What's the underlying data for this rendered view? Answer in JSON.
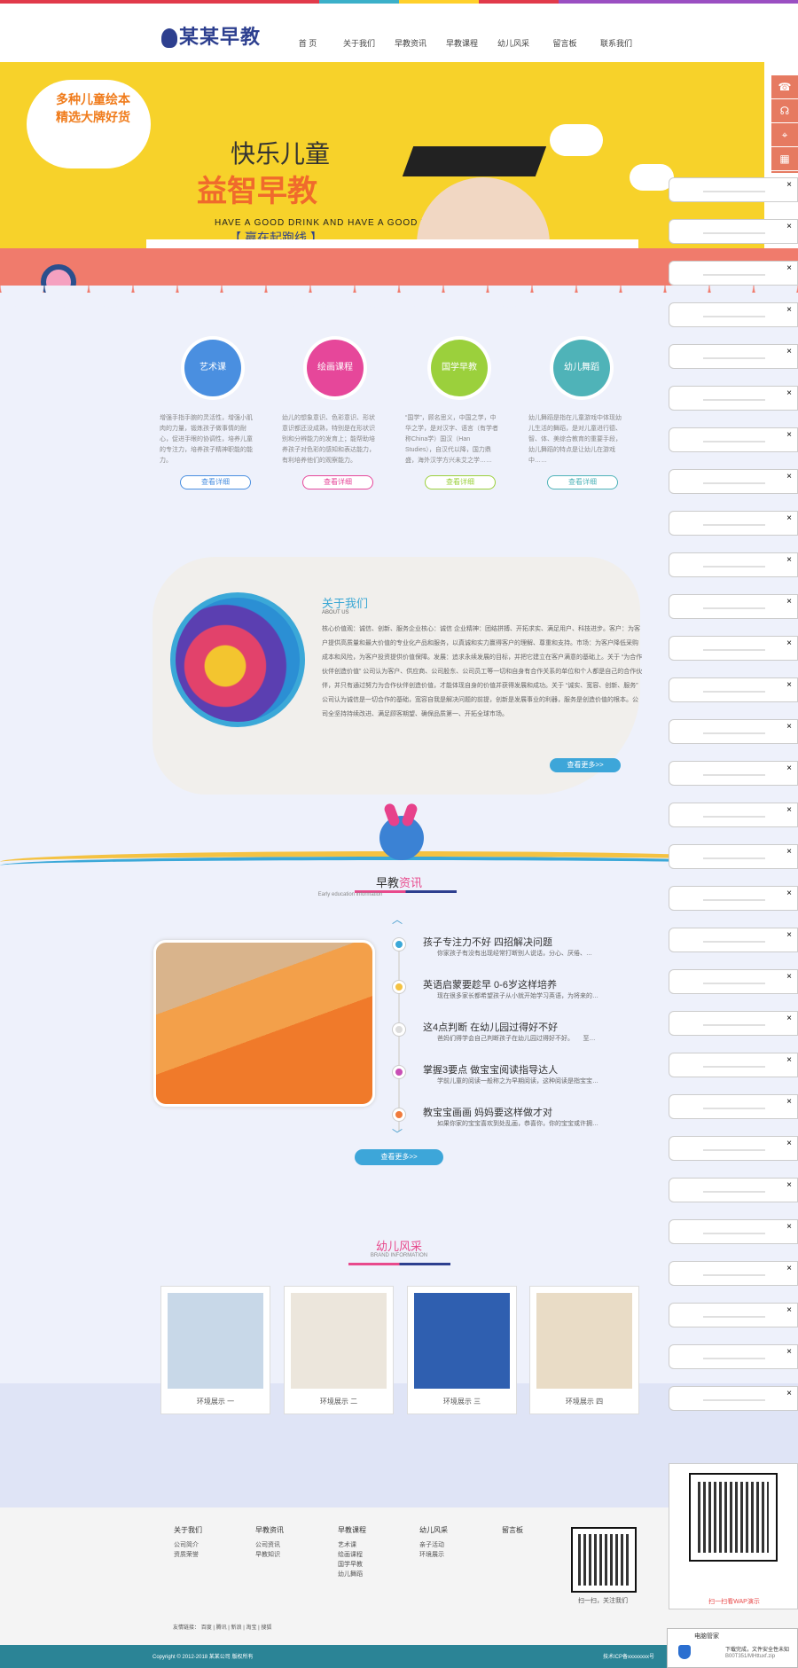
{
  "brand": {
    "logo_text": "某某早教"
  },
  "nav": [
    "首 页",
    "关于我们",
    "早教资讯",
    "早教课程",
    "幼儿风采",
    "留言板",
    "联系我们"
  ],
  "banner": {
    "bubble_line1": "多种儿童绘本",
    "bubble_line2": "精选大牌好货",
    "headline1": "快乐儿童",
    "headline2": "益智早教",
    "tagline": "HAVE A GOOD DRINK AND HAVE A GOOD TIME",
    "slogan": "【 赢在起跑线 】"
  },
  "features": [
    {
      "title": "艺术课",
      "color": "#4a8fe0",
      "desc": "增强手指手腕的灵活性，增强小肌肉的力量，锻炼孩子做事情的耐心，促进手眼的协调性，培养儿童的专注力，培养孩子精神职能的能力。",
      "btn": "查看详细",
      "btncolor": "#4a8fe0"
    },
    {
      "title": "绘画课程",
      "color": "#e6479a",
      "desc": "幼儿的想象意识、色彩意识、形状意识都还没成熟，特别是在形状识别和分辨能力的发育上；能帮助培养孩子对色彩的感知和表达能力，有利培养他们的观察能力。",
      "btn": "查看详细",
      "btncolor": "#e6479a"
    },
    {
      "title": "国学早教",
      "color": "#9bd03c",
      "desc": "“国学”，顾名思义，中国之学，中华之学，是对汉字、语言（有学者称China学）国汉（Han Studies），自汉代以降，国力鼎盛，海外汉学方兴未艾之学……",
      "btn": "查看详细",
      "btncolor": "#9bd03c"
    },
    {
      "title": "幼儿舞蹈",
      "color": "#4fb3b8",
      "desc": "幼儿舞蹈是指在儿童游戏中体现幼儿生活的舞蹈，是对儿童进行德、智、体、美综合教育的重要手段，幼儿舞蹈的特点是让幼儿在游戏中……",
      "btn": "查看详细",
      "btncolor": "#4fb3b8"
    }
  ],
  "about": {
    "title": "关于我们",
    "subtitle": "ABOUT US",
    "text": "核心价值观：诚信、创新、服务企业核心：诚信 企业精神：团结拼搏、开拓求实、满足用户、科技进步。客户：为客户提供高质量和最大价值的专业化产品和服务，以真诚和实力赢得客户的理解、尊重和支持。市场：为客户降低采购成本和风险，为客户投资提供价值保障。发展：追求永续发展的目标，并把它建立在客户满意的基础上。关于 “为合作伙伴创造价值” 公司认为客户、供应商、公司股东、公司员工等一切和自身有合作关系的单位和个人都是自己的合作伙伴，并只有通过努力为合作伙伴创造价值，才能体现自身的价值并获得发展和成功。关于 “诚实、宽容、创新、服务” 公司认为诚信是一切合作的基础，宽容自我是解决问题的前提，创新是发展事业的利器，服务是创造价值的根本。公司全坚持持续改进、满足顾客期望、确保品质第一、开拓全球市场。",
    "more": "查看更多>>"
  },
  "news": {
    "title_plain": "早教",
    "title_hi": "资讯",
    "subtitle": "Early education information",
    "items": [
      {
        "title": "孩子专注力不好 四招解决问题",
        "desc": "你家孩子有没有出现经常打断别人说话，分心、厌倦、…",
        "dot": "#3ba8d8"
      },
      {
        "title": "英语启蒙要趁早 0-6岁这样培养",
        "desc": "现在很多家长都希望孩子从小就开始学习英语，为将来的…",
        "dot": "#f4c242"
      },
      {
        "title": "这4点判断 在幼儿园过得好不好",
        "desc": "爸妈们得学会自己判断孩子在幼儿园过得好不好。　　至…",
        "dot": "#dddddd"
      },
      {
        "title": "掌握3要点 做宝宝阅读指导达人",
        "desc": "学前儿童的阅读一般称之为早期阅读，这种阅读是指宝宝…",
        "dot": "#c84fb5"
      },
      {
        "title": "教宝宝画画 妈妈要这样做才对",
        "desc": "如果你家的宝宝喜欢到处乱画，恭喜你，你的宝宝或许拥…",
        "dot": "#f07b3c"
      }
    ],
    "more": "查看更多>>"
  },
  "gallery": {
    "title": "幼儿风采",
    "subtitle": "BRAND INFORMATION",
    "items": [
      {
        "caption": "环境展示 一",
        "bg": "#c8d8e8"
      },
      {
        "caption": "环境展示 二",
        "bg": "#ece6dc"
      },
      {
        "caption": "环境展示 三",
        "bg": "#2f5fb0"
      },
      {
        "caption": "环境展示 四",
        "bg": "#e9dcc6"
      }
    ]
  },
  "footer": {
    "cols": [
      {
        "title": "关于我们",
        "items": [
          "公司简介",
          "资质荣誉"
        ]
      },
      {
        "title": "早教资讯",
        "items": [
          "公司资讯",
          "早教知识"
        ]
      },
      {
        "title": "早教课程",
        "items": [
          "艺术课",
          "绘画课程",
          "国学早教",
          "幼儿舞蹈"
        ]
      },
      {
        "title": "幼儿风采",
        "items": [
          "亲子活动",
          "环境展示"
        ]
      },
      {
        "title": "留言板",
        "items": []
      }
    ],
    "qr_caption": "扫一扫，关注我们",
    "links_label": "友情链接：",
    "links": [
      "百度",
      "腾讯",
      "新浪",
      "淘宝",
      "搜狐"
    ],
    "copyright": "Copyright © 2012-2018 某某公司 版权所有",
    "icp": "技术ICP备xxxxxxxx号"
  },
  "side": {
    "icons": [
      "phone-icon",
      "headset-icon",
      "location-icon",
      "qrcode-icon"
    ],
    "qr_caption": "扫一扫看WAP演示",
    "close": "×"
  },
  "toast": {
    "title": "电脑管家",
    "line1": "下载完成，文件安全性未知",
    "line2": "B00T351/MHttuxf.zip"
  }
}
